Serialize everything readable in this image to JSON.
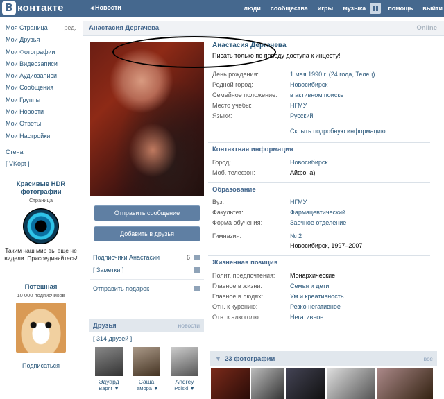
{
  "header": {
    "logo_letter": "В",
    "logo_text": "контакте",
    "news_link": "◂ Новости",
    "nav": [
      "люди",
      "сообщества",
      "игры",
      "музыка",
      "помощь",
      "выйти"
    ]
  },
  "sidebar": {
    "items": [
      "Моя Страница",
      "Мои Друзья",
      "Мои Фотографии",
      "Мои Видеозаписи",
      "Мои Аудиозаписи",
      "Мои Сообщения",
      "Мои Группы",
      "Мои Новости",
      "Мои Ответы",
      "Мои Настройки"
    ],
    "edit_label": "ред.",
    "extra": [
      "Стена",
      "[ VKopt ]"
    ]
  },
  "ads": [
    {
      "title": "Красивые HDR фотографии",
      "subtitle": "Страница",
      "text": "Таким наш мир вы еще не видели. Присоединяйтесь!"
    },
    {
      "title": "Потешная",
      "subtitle": "10 000 подписчиков",
      "link": "Подписаться"
    }
  ],
  "profile": {
    "title_name": "Анастасия Дергачева",
    "online": "Online",
    "name": "Анастасия Дергачева",
    "status": "Писать только по поводу доступа к инцесту!",
    "info": [
      {
        "k": "День рождения:",
        "v": "1 мая 1990 г. (24 года, Телец)"
      },
      {
        "k": "Родной город:",
        "v": "Новосибирск"
      },
      {
        "k": "Семейное положение:",
        "v": "в активном поиске"
      },
      {
        "k": "Место учебы:",
        "v": "НГМУ"
      },
      {
        "k": "Языки:",
        "v": "Русский"
      }
    ],
    "show_more": "Скрыть подробную информацию",
    "contact_title": "Контактная информация",
    "contact": [
      {
        "k": "Город:",
        "v": "Новосибирск"
      },
      {
        "k": "Моб. телефон:",
        "v": "Айфона)"
      }
    ],
    "education_title": "Образование",
    "education": [
      {
        "k": "Вуз:",
        "v": "НГМУ"
      },
      {
        "k": "Факультет:",
        "v": "Фармацевтический"
      },
      {
        "k": "Форма обучения:",
        "v": "Заочное отделение"
      }
    ],
    "school_k": "Гимназия:",
    "school_v1": "№ 2",
    "school_v2": "Новосибирск, 1997–2007",
    "position_title": "Жизненная позиция",
    "position": [
      {
        "k": "Полит. предпочтения:",
        "v": "Монархические"
      },
      {
        "k": "Главное в жизни:",
        "v": "Семья и дети"
      },
      {
        "k": "Главное в людях:",
        "v": "Ум и креативность"
      },
      {
        "k": "Отн. к курению:",
        "v": "Резко негативное"
      },
      {
        "k": "Отн. к алкоголю:",
        "v": "Негативное"
      }
    ],
    "photos_title": "23 фотографии",
    "photos_all": "все"
  },
  "left": {
    "send_message": "Отправить сообщение",
    "add_friend": "Добавить в друзья",
    "subscribers": "Подписчики Анастасии",
    "subscribers_count": "6",
    "notes": "[ Заметки ]",
    "gift": "Отправить подарок",
    "friends_title": "Друзья",
    "friends_new": "новости",
    "friends_count": "[ 314 друзей ]",
    "friends": [
      {
        "name": "Эдуард",
        "sub": "Варяг ▼"
      },
      {
        "name": "Саша",
        "sub": "Гамора ▼"
      },
      {
        "name": "Andrey",
        "sub": "Polski ▼"
      }
    ]
  }
}
